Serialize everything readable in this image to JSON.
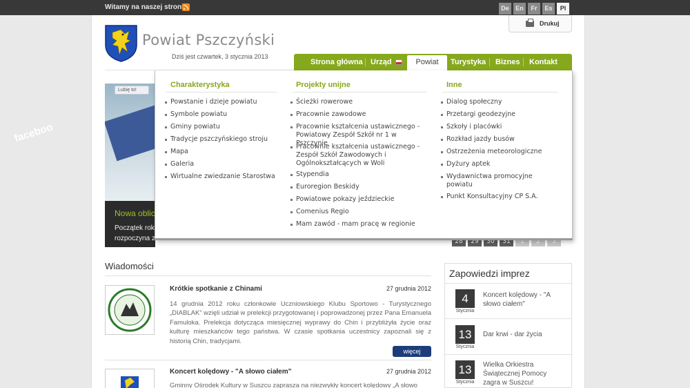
{
  "topbar": {
    "welcome": "Witamy na naszej stronie",
    "languages": [
      "De",
      "En",
      "Fr",
      "Es",
      "Pl"
    ],
    "active_language": "Pl"
  },
  "header": {
    "print_label": "Drukuj",
    "site_title": "Powiat Pszczyński",
    "date_line": "Dziś jest czwartek, 3 stycznia 2013"
  },
  "nav": {
    "items": [
      "Strona główna",
      "Urząd",
      "Powiat",
      "Turystyka",
      "Biznes",
      "Kontakt"
    ],
    "active": "Powiat"
  },
  "dropdown": {
    "columns": [
      {
        "heading": "Charakterystyka",
        "items": [
          "Powstanie i dzieje powiatu",
          "Symbole powiatu",
          "Gminy powiatu",
          "Tradycje pszczyńskiego stroju",
          "Mapa",
          "Galeria",
          "Wirtualne zwiedzanie Starostwa"
        ]
      },
      {
        "heading": "Projekty unijne",
        "items": [
          "Ścieżki rowerowe",
          "Pracownie zawodowe",
          "Pracownie kształcenia ustawicznego - Powiatowy Zespół Szkół nr 1 w Pszczynie",
          "Pracownie kształcenia ustawicznego - Zespół Szkół Zawodowych i Ogólnokształcących w Woli",
          "Stypendia",
          "Euroregion Beskidy",
          "Powiatowe pokazy jeździeckie",
          "Comenius Regio",
          "Mam zawód - mam pracę w regionie"
        ]
      },
      {
        "heading": "Inne",
        "items": [
          "Dialog społeczny",
          "Przetargi geodezyjne",
          "Szkoły i placówki",
          "Rozkład jazdy busów",
          "Ostrzeżenia meteorologiczne",
          "Dyżury aptek",
          "Wydawnictwa promocyjne powiatu",
          "Punkt Konsultacyjny CP S.A."
        ]
      }
    ]
  },
  "banner": {
    "like_label": "Lubię to!",
    "fb_text": "faceboo",
    "caption_title": "Nowa oblic",
    "caption_text_1": "Początek rok",
    "caption_text_2": "rozpoczyna z"
  },
  "calendar_row": [
    "28",
    "29",
    "30",
    "31",
    "1",
    "2",
    "3"
  ],
  "news": {
    "heading": "Wiadomości",
    "items": [
      {
        "title": "Krótkie spotkanie z Chinami",
        "date": "27 grudnia 2012",
        "text": "14 grudnia 2012 roku członkowie Uczniowskiego Klubu Sportowo - Turystycznego „DIABLAK” wzięli udział w prelekcji przygotowanej i poprowadzonej przez Pana Emanuela Famuloka. Prelekcja dotycząca miesięcznej wyprawy do Chin i przybliżyła życie oraz kulturę mieszkańców tego państwa. W czasie spotkania uczestnicy zapoznali się z historią Chin, tradycjami.",
        "more": "więcej"
      },
      {
        "title": "Koncert kolędowy - \"A słowo ciałem\"",
        "date": "27 grudnia 2012",
        "text": "Gminny Ośrodek Kultury w Suszcu zaprasza na niezwykły koncert kolędowy „A słowo"
      }
    ]
  },
  "events": {
    "title": "Zapowiedzi imprez",
    "items": [
      {
        "day": "4",
        "month": "Stycznia",
        "name": "Koncert kolędowy - \"A słowo ciałem\""
      },
      {
        "day": "13",
        "month": "Stycznia",
        "name": "Dar krwi - dar życia"
      },
      {
        "day": "13",
        "month": "Stycznia",
        "name": "Wielka Orkiestra Świątecznej Pomocy zagra w Suszcu!"
      }
    ]
  },
  "colors": {
    "nav_green": "#86a81c",
    "heading_green": "#86a81c",
    "button_blue": "#1d3d7a",
    "topbar": "#383838"
  }
}
